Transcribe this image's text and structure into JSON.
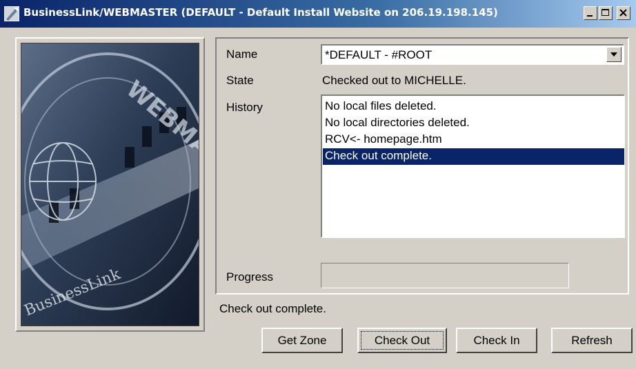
{
  "window": {
    "title": "BusinessLink/WEBMASTER (DEFAULT - Default Install Website on 206.19.198.145)"
  },
  "form": {
    "name_label": "Name",
    "name_value": "*DEFAULT - #ROOT",
    "state_label": "State",
    "state_value": "Checked out to MICHELLE.",
    "history_label": "History",
    "history_items": [
      "No local files deleted.",
      "No local directories deleted.",
      "RCV<- homepage.htm",
      "Check out complete."
    ],
    "history_selected_index": 3,
    "progress_label": "Progress",
    "progress_value": 0
  },
  "status_text": "Check out complete.",
  "buttons": {
    "get_zone": "Get Zone",
    "check_out": "Check Out",
    "check_in": "Check In",
    "refresh": "Refresh"
  },
  "image": {
    "ring_text_top": "WEBMASTER",
    "ring_text_bottom": "BusinessLink"
  },
  "colors": {
    "title_bar": "#0a246a",
    "selection": "#0a246a",
    "face": "#d4d0c8"
  }
}
